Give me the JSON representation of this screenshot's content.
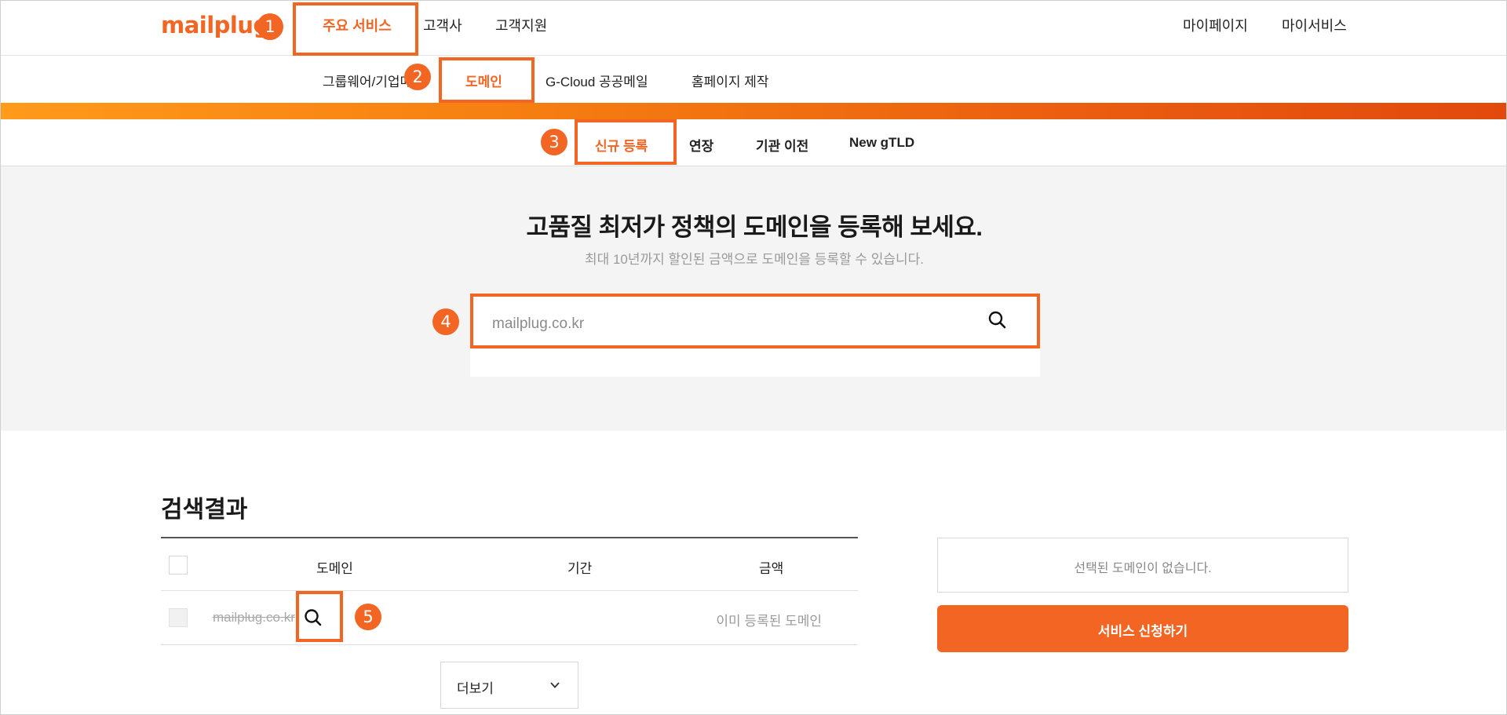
{
  "brand": {
    "logo": "mailplug",
    "accent": "#f26522"
  },
  "top_nav": {
    "items": [
      "주요 서비스",
      "고객사",
      "고객지원"
    ],
    "right": [
      "마이페이지",
      "마이서비스"
    ]
  },
  "sub_nav": {
    "items": [
      "그룹웨어/기업메",
      "도메인",
      "G-Cloud 공공메일",
      "홈페이지 제작"
    ]
  },
  "tabs": {
    "items": [
      "신규 등록",
      "연장",
      "기관 이전",
      "New gTLD"
    ]
  },
  "hero": {
    "title": "고품질 최저가 정책의 도메인을 등록해 보세요.",
    "subtitle": "최대 10년까지 할인된 금액으로 도메인을 등록할 수 있습니다.",
    "search_placeholder": "mailplug.co.kr",
    "search_icon": "search-icon"
  },
  "results": {
    "title": "검색결과",
    "columns": [
      "도메인",
      "기간",
      "금액"
    ],
    "rows": [
      {
        "domain": "mailplug.co.kr",
        "status": "이미 등록된 도메인"
      }
    ],
    "more_label": "더보기"
  },
  "cart": {
    "empty_text": "선택된 도메인이 없습니다.",
    "apply_label": "서비스 신청하기"
  },
  "annotations": [
    "1",
    "2",
    "3",
    "4",
    "5"
  ]
}
